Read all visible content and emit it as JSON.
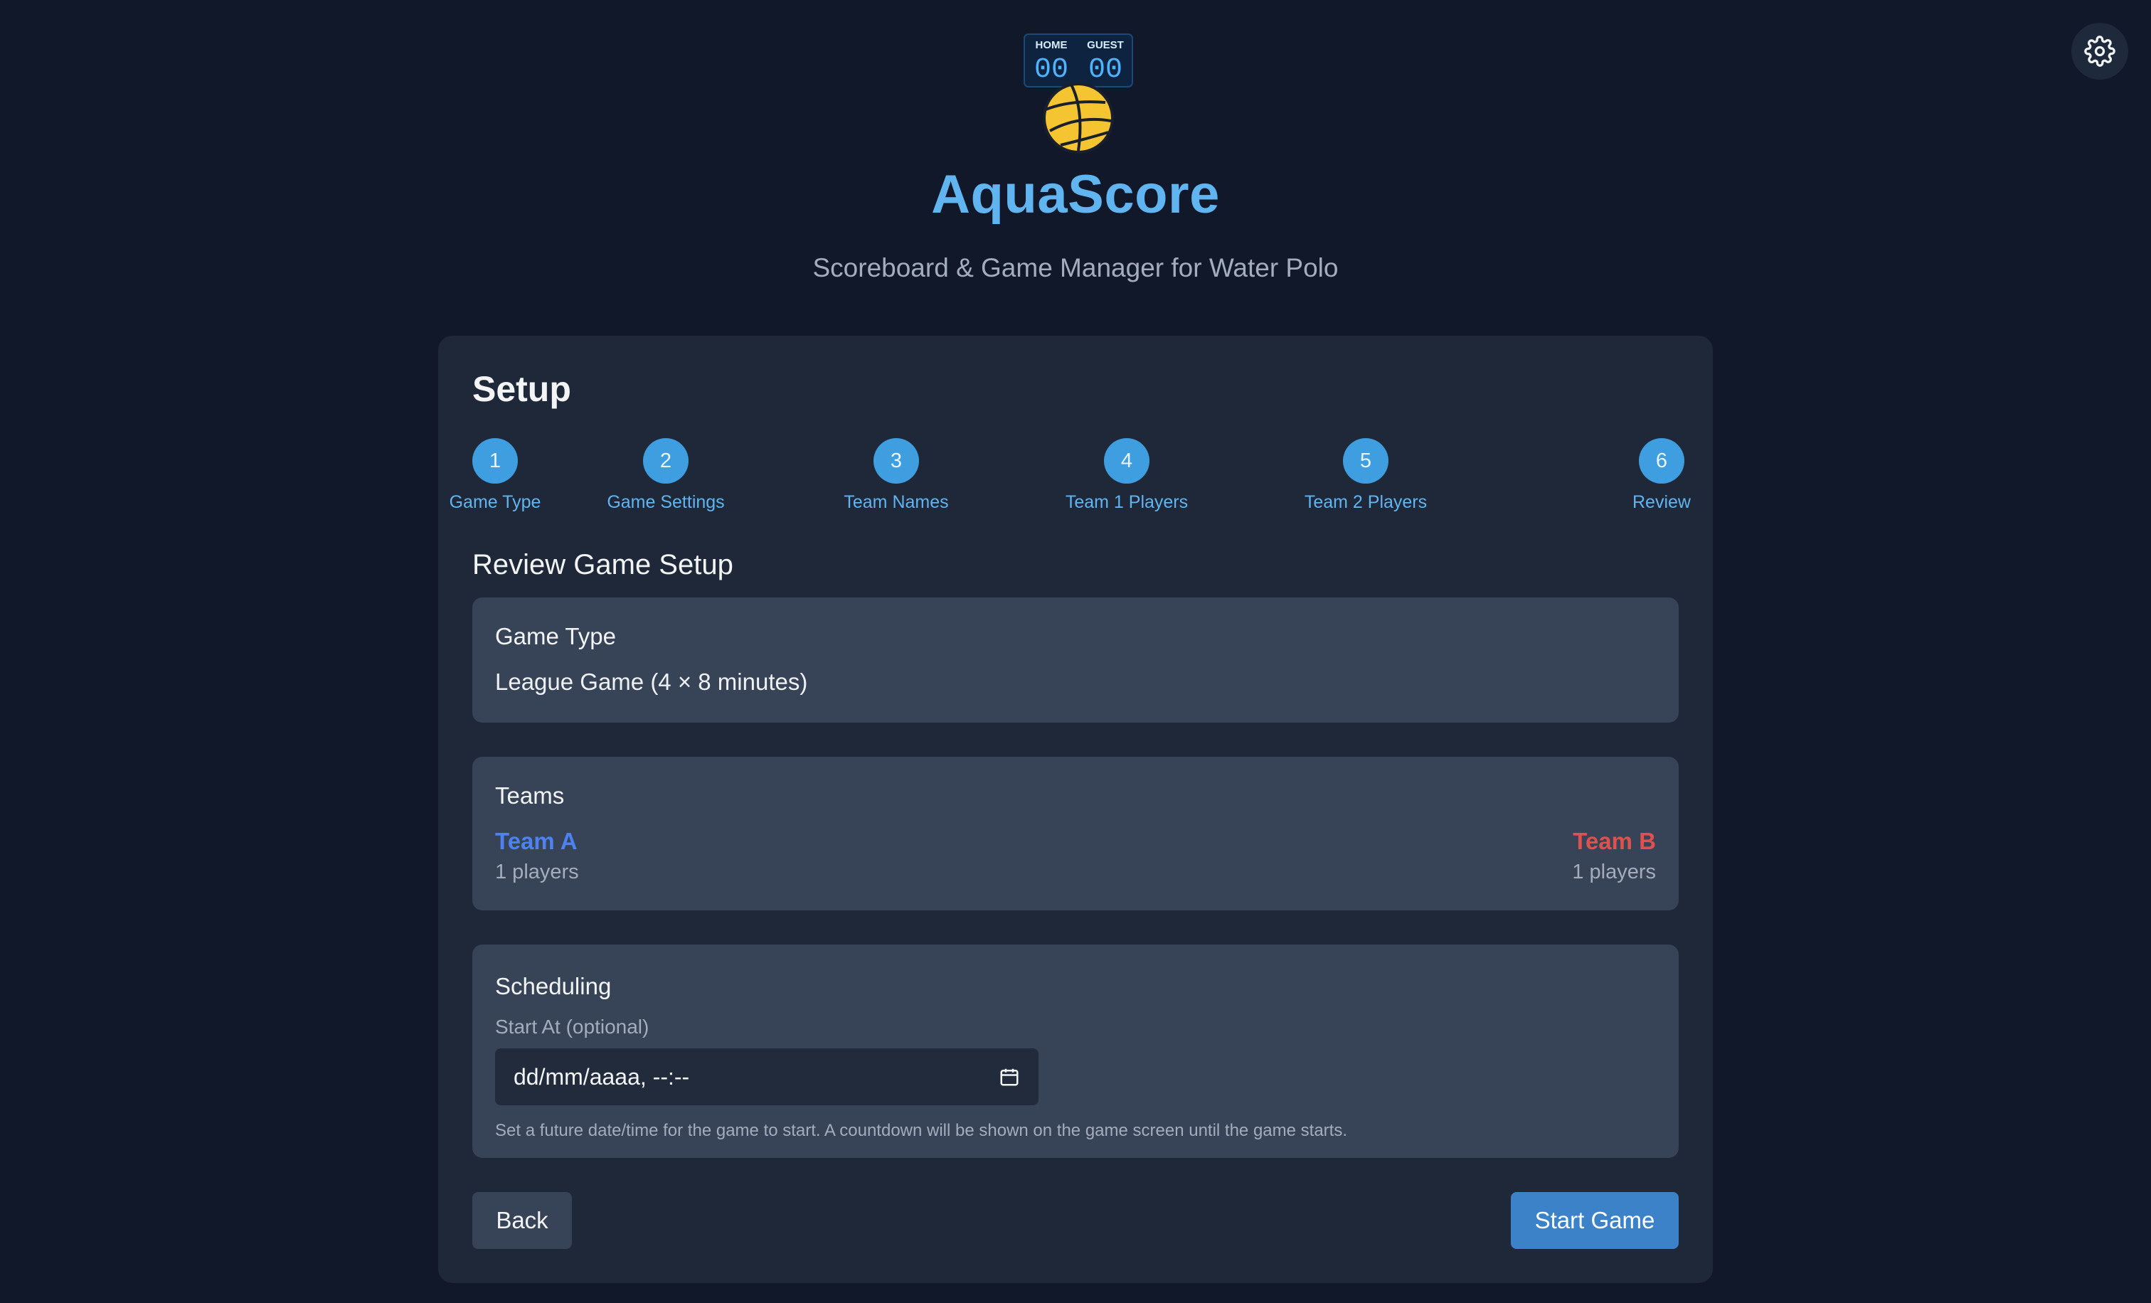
{
  "logo": {
    "home_label": "HOME",
    "guest_label": "GUEST",
    "home_score": "00",
    "guest_score": "00",
    "icon": "water-polo-ball-icon"
  },
  "header": {
    "title": "AquaScore",
    "subtitle": "Scoreboard & Game Manager for Water Polo"
  },
  "settings": {
    "icon": "gear-icon"
  },
  "setup": {
    "title": "Setup",
    "steps": [
      {
        "number": "1",
        "label": "Game Type"
      },
      {
        "number": "2",
        "label": "Game Settings"
      },
      {
        "number": "3",
        "label": "Team Names"
      },
      {
        "number": "4",
        "label": "Team 1 Players"
      },
      {
        "number": "5",
        "label": "Team 2 Players"
      },
      {
        "number": "6",
        "label": "Review"
      }
    ]
  },
  "review": {
    "title": "Review Game Setup",
    "game_type": {
      "heading": "Game Type",
      "value": "League Game (4 × 8 minutes)"
    },
    "teams": {
      "heading": "Teams",
      "team_a": {
        "name": "Team A",
        "players": "1 players",
        "color": "#4d82f0"
      },
      "team_b": {
        "name": "Team B",
        "players": "1 players",
        "color": "#e0504f"
      }
    },
    "scheduling": {
      "heading": "Scheduling",
      "start_label": "Start At (optional)",
      "start_value": "dd/mm/aaaa, --:--",
      "hint": "Set a future date/time for the game to start. A countdown will be shown on the game screen until the game starts."
    }
  },
  "actions": {
    "back_label": "Back",
    "start_label": "Start Game"
  },
  "colors": {
    "background": "#101829",
    "card": "#1f2838",
    "panel": "#374356",
    "accent": "#60b4f0",
    "step_circle": "#3f9ee0",
    "primary_button": "#3b82c9"
  }
}
